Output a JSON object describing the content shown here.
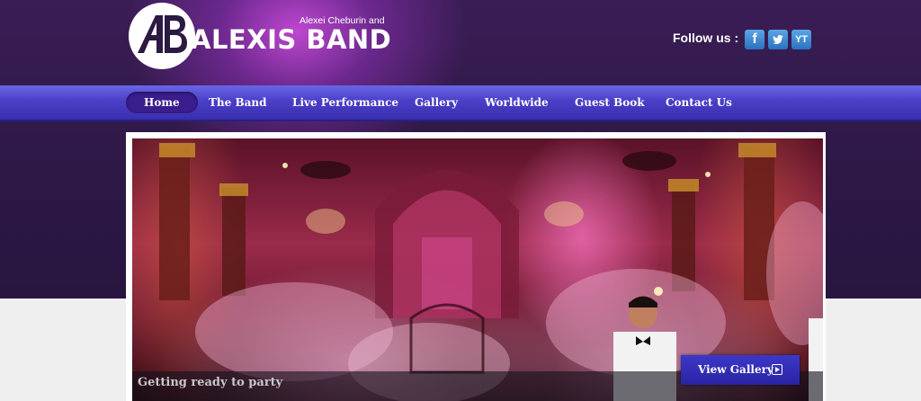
{
  "header": {
    "logo_letters": "AB",
    "brand_name": "ALEXIS BAND",
    "brand_subtitle": "Alexei Cheburin and",
    "follow_label": "Follow us :",
    "social": [
      {
        "name": "facebook",
        "glyph": "f"
      },
      {
        "name": "twitter",
        "glyph": "bird"
      },
      {
        "name": "youtube",
        "glyph": "YT"
      }
    ]
  },
  "nav": {
    "items": [
      {
        "label": "Home",
        "active": true
      },
      {
        "label": "The Band",
        "active": false
      },
      {
        "label": "Live Performance",
        "active": false
      },
      {
        "label": "Gallery",
        "active": false
      },
      {
        "label": "Worldwide",
        "active": false
      },
      {
        "label": "Guest Book",
        "active": false
      },
      {
        "label": "Contact Us",
        "active": false
      }
    ]
  },
  "slideshow": {
    "caption": "Getting ready to party",
    "button_label": "View Gallery"
  },
  "colors": {
    "background": "#2c1a42",
    "nav": "#4a3fc8",
    "button": "#2a23a4",
    "light_area": "#efefef"
  }
}
